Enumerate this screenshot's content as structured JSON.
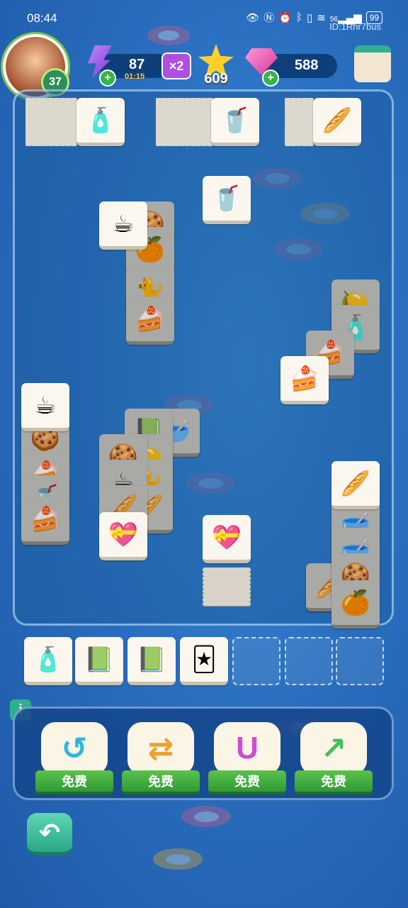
{
  "status_bar": {
    "time": "08:44",
    "battery": "99",
    "signal": "56",
    "device_id": "ID:1Rhr7bus"
  },
  "player": {
    "level": "37"
  },
  "resources": {
    "energy": "87",
    "energy_timer": "01:15",
    "multiplier": "×2",
    "stars": "609",
    "gems": "588"
  },
  "icons": {
    "avatar": "player-avatar",
    "energy": "lightning-bolt-icon",
    "star": "star-icon",
    "gem": "gem-icon",
    "shop": "shop-stall-icon",
    "info": "info-icon",
    "undo": "back-arrow-icon"
  },
  "tile_types": {
    "perfume": "🧴",
    "smoothie": "🥤",
    "bread": "🥖",
    "coffee": "☕",
    "macaron": "🍪",
    "orange": "🍊",
    "cat": "🐈",
    "cake": "🍰",
    "heart_box": "💝",
    "book": "📗",
    "cards": "🃏",
    "lemon": "🍋",
    "cup": "🥣"
  },
  "tray": {
    "filled": [
      "perfume",
      "book",
      "book",
      "cards"
    ],
    "capacity": 7
  },
  "tools": [
    {
      "name": "shuffle",
      "label": "免费",
      "icon": "undo-arrow-icon",
      "color": "#2fb6e0"
    },
    {
      "name": "swap",
      "label": "免费",
      "icon": "swap-arrows-icon",
      "color": "#f0a030"
    },
    {
      "name": "magnet",
      "label": "免费",
      "icon": "magnet-icon",
      "color": "#d04ad8"
    },
    {
      "name": "boost",
      "label": "免费",
      "icon": "up-arrow-icon",
      "color": "#3fc25a"
    }
  ],
  "colors": {
    "accent_green": "#2fb08f",
    "free_ribbon": "#4cb548",
    "board_bg": "#1e5fa0"
  }
}
